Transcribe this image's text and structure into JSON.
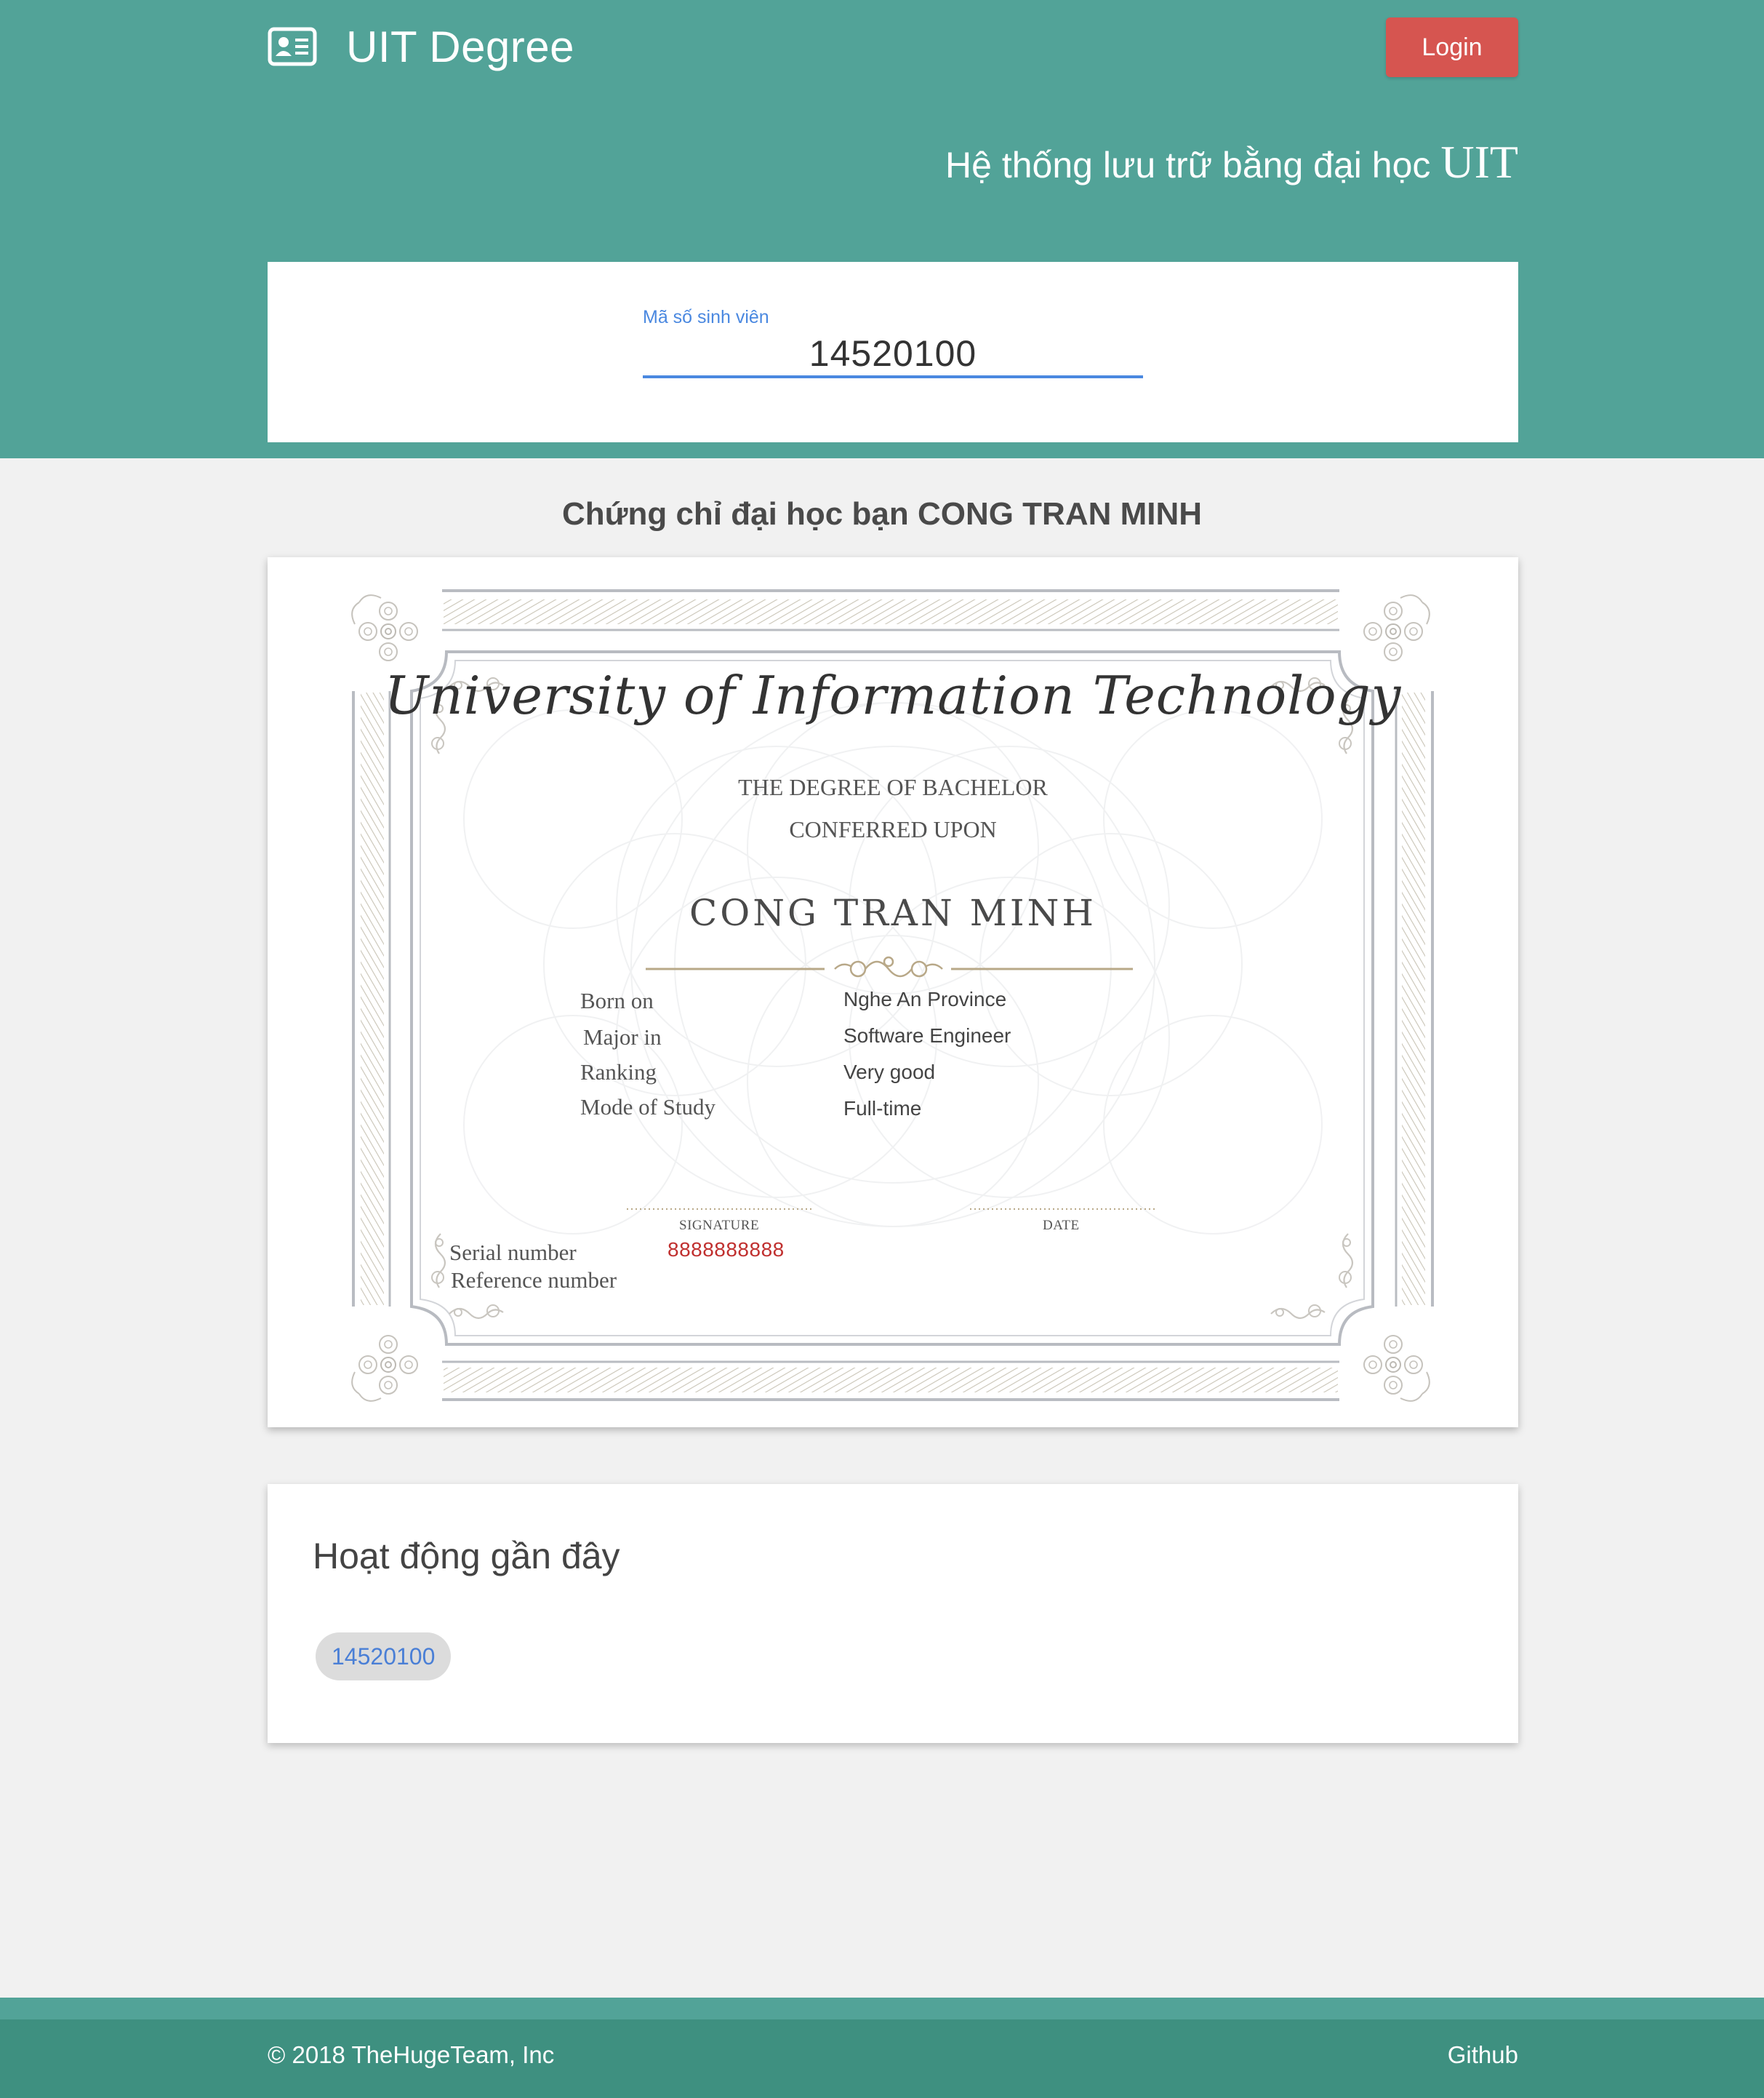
{
  "header": {
    "brand": "UIT Degree",
    "login_label": "Login",
    "tagline": "Hệ thống lưu trữ bằng đại học",
    "tagline_strong": "UIT",
    "brand_icon": "id-card-icon"
  },
  "search": {
    "label": "Mã số sinh viên",
    "value": "14520100"
  },
  "certificate": {
    "heading": "Chứng chỉ đại học bạn CONG TRAN MINH",
    "university": "University of Information Technology",
    "degree": "THE DEGREE OF BACHELOR",
    "conferred": "CONFERRED UPON",
    "recipient": "CONG TRAN MINH",
    "fields": [
      {
        "label": "Born on",
        "value": "Nghe An Province"
      },
      {
        "label": "Major in",
        "value": "Software Engineer"
      },
      {
        "label": "Ranking",
        "value": "Very good"
      },
      {
        "label": "Mode of Study",
        "value": "Full-time"
      }
    ],
    "signature_label": "SIGNATURE",
    "date_label": "DATE",
    "serial_label": "Serial number",
    "serial_value": "8888888888",
    "reference_label": "Reference number",
    "accent_color": "#c0302f"
  },
  "activity": {
    "title": "Hoạt động gần đây",
    "items": [
      "14520100"
    ]
  },
  "footer": {
    "copyright": "© 2018 TheHugeTeam, Inc",
    "github": "Github"
  },
  "colors": {
    "primary": "#52a398",
    "login": "#d65550",
    "link": "#4a88e0"
  }
}
